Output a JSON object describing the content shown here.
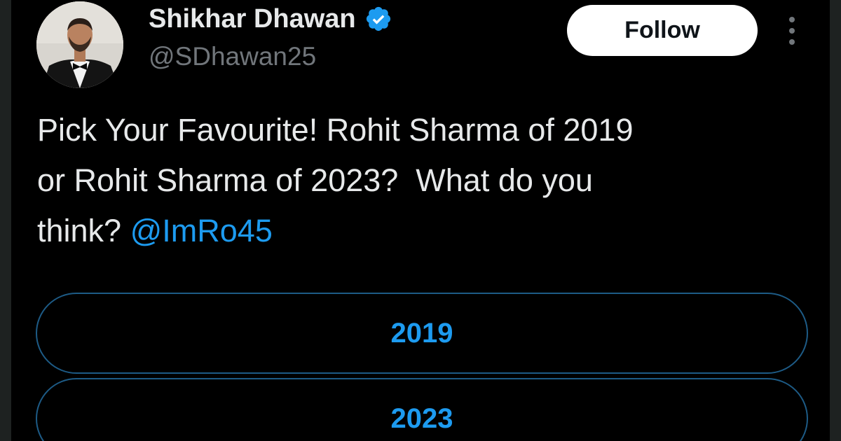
{
  "tweet": {
    "author_name": "Shikhar Dhawan",
    "handle": "@SDhawan25",
    "verified_icon": "verified-badge-icon",
    "follow_label": "Follow",
    "more_icon": "more-vertical-icon",
    "text": "Pick Your Favourite! Rohit Sharma of 2019\nor Rohit Sharma of 2023?  What do you\nthink? ",
    "mention": "@ImRo45"
  },
  "poll": {
    "options": [
      {
        "label": "2019"
      },
      {
        "label": "2023"
      }
    ]
  },
  "colors": {
    "background": "#000000",
    "accent": "#1d9bf0",
    "text": "#e7e9ea",
    "muted": "#71767b",
    "poll_border": "#1d5b86"
  }
}
